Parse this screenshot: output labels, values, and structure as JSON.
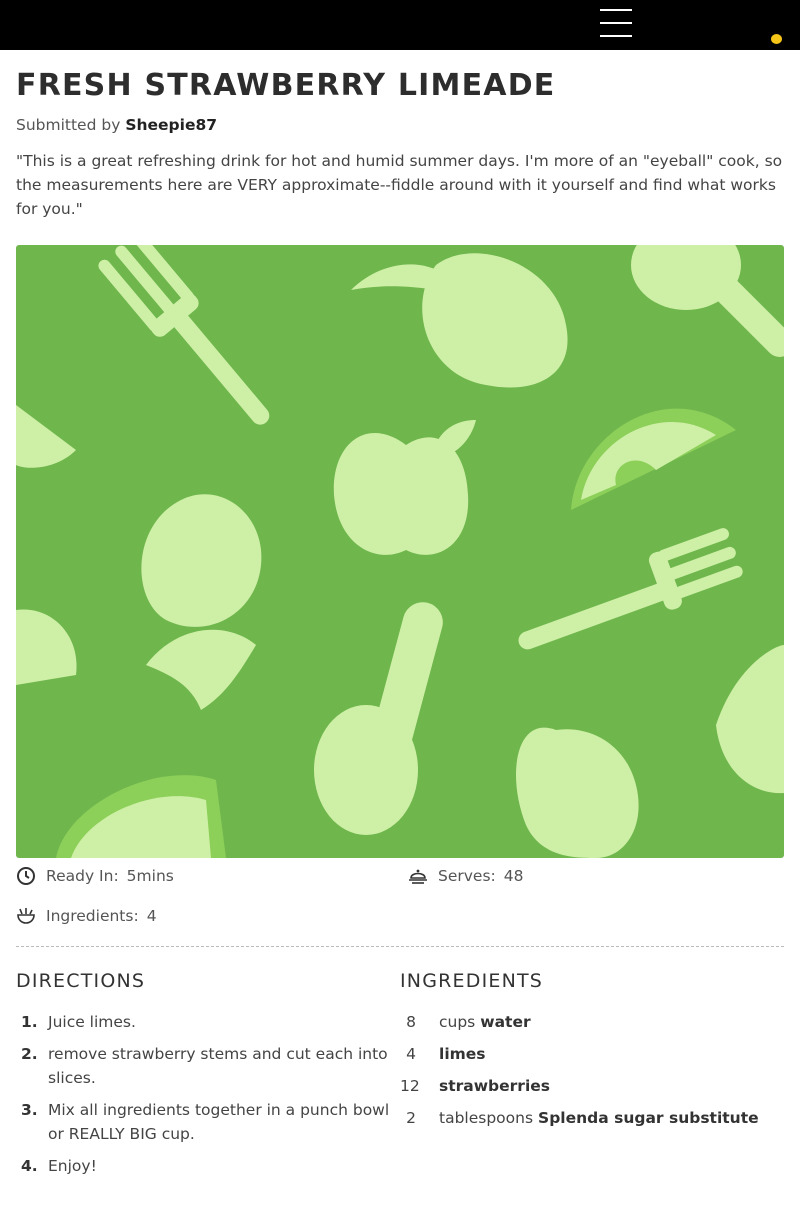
{
  "header": {
    "menu_icon": "hamburger-menu-icon",
    "notification_color": "#f5c518"
  },
  "recipe": {
    "title": "FRESH STRAWBERRY LIMEADE",
    "submitted_by_label": "Submitted by",
    "author": "Sheepie87",
    "description": "\"This is a great refreshing drink for hot and humid summer days. I'm more of an \"eyeball\" cook, so the measurements here are VERY approximate--fiddle around with it yourself and find what works for you.\""
  },
  "hero": {
    "background_color": "#6fb64d",
    "pattern_color": "#cef0a6",
    "pattern": "food-illustration-placeholder"
  },
  "meta": {
    "ready_in_label": "Ready In:",
    "ready_in_value": "5mins",
    "serves_label": "Serves:",
    "serves_value": "48",
    "ingredients_label": "Ingredients:",
    "ingredients_value": "4"
  },
  "directions": {
    "title": "DIRECTIONS",
    "steps": [
      {
        "num": "1.",
        "text": "Juice limes."
      },
      {
        "num": "2.",
        "text": "remove strawberry stems and cut each into slices."
      },
      {
        "num": "3.",
        "text": "Mix all ingredients together in a punch bowl or REALLY BIG cup."
      },
      {
        "num": "4.",
        "text": "Enjoy!"
      }
    ]
  },
  "ingredients": {
    "title": "INGREDIENTS",
    "items": [
      {
        "qty": "8",
        "unit": "cups",
        "name": "water"
      },
      {
        "qty": "4",
        "unit": "",
        "name": "limes"
      },
      {
        "qty": "12",
        "unit": "",
        "name": "strawberries"
      },
      {
        "qty": "2",
        "unit": "tablespoons",
        "name": "Splenda sugar substitute"
      }
    ]
  }
}
